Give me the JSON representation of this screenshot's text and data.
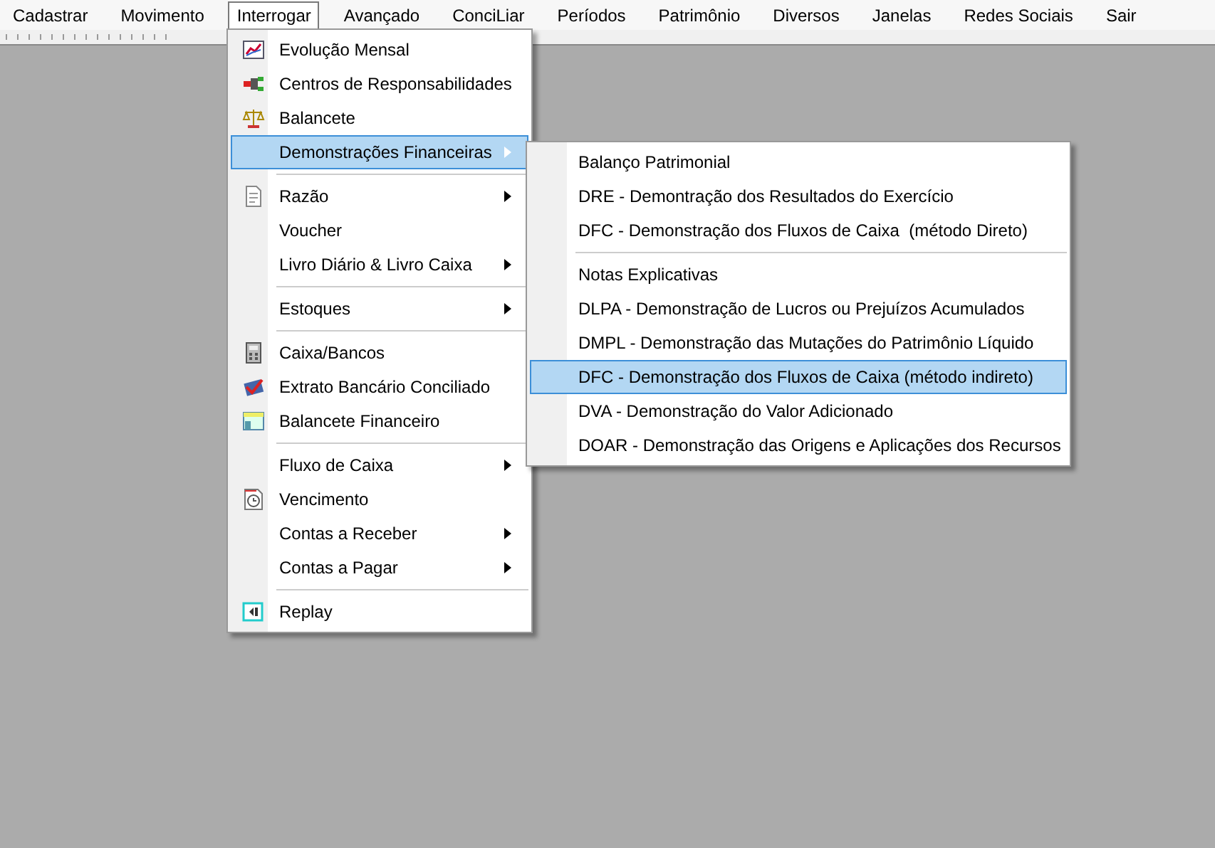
{
  "menu_bar": [
    {
      "label": "Cadastrar",
      "selected": false
    },
    {
      "label": "Movimento",
      "selected": false
    },
    {
      "label": "Interrogar",
      "selected": true
    },
    {
      "label": "Avançado",
      "selected": false
    },
    {
      "label": "ConciLiar",
      "selected": false
    },
    {
      "label": "Períodos",
      "selected": false
    },
    {
      "label": "Patrimônio",
      "selected": false
    },
    {
      "label": "Diversos",
      "selected": false
    },
    {
      "label": "Janelas",
      "selected": false
    },
    {
      "label": "Redes Sociais",
      "selected": false
    },
    {
      "label": "Sair",
      "selected": false
    }
  ],
  "menu": [
    {
      "kind": "item",
      "label": "Evolução Mensal",
      "selected": false,
      "submenu": false
    },
    {
      "kind": "item",
      "label": "Centros de Responsabilidades",
      "selected": false,
      "submenu": false
    },
    {
      "kind": "item",
      "label": "Balancete",
      "selected": false,
      "submenu": false
    },
    {
      "kind": "item",
      "label": "Demonstrações Financeiras",
      "selected": true,
      "submenu": true
    },
    {
      "kind": "separator"
    },
    {
      "kind": "item",
      "label": "Razão",
      "selected": false,
      "submenu": true
    },
    {
      "kind": "item",
      "label": "Voucher",
      "selected": false,
      "submenu": false
    },
    {
      "kind": "item",
      "label": "Livro Diário & Livro Caixa",
      "selected": false,
      "submenu": true
    },
    {
      "kind": "separator"
    },
    {
      "kind": "item",
      "label": "Estoques",
      "selected": false,
      "submenu": true
    },
    {
      "kind": "separator"
    },
    {
      "kind": "item",
      "label": "Caixa/Bancos",
      "selected": false,
      "submenu": false
    },
    {
      "kind": "item",
      "label": "Extrato Bancário Conciliado",
      "selected": false,
      "submenu": false
    },
    {
      "kind": "item",
      "label": "Balancete Financeiro",
      "selected": false,
      "submenu": false
    },
    {
      "kind": "separator"
    },
    {
      "kind": "item",
      "label": "Fluxo de Caixa",
      "selected": false,
      "submenu": true
    },
    {
      "kind": "item",
      "label": "Vencimento",
      "selected": false,
      "submenu": false
    },
    {
      "kind": "item",
      "label": "Contas a Receber",
      "selected": false,
      "submenu": true
    },
    {
      "kind": "item",
      "label": "Contas a Pagar",
      "selected": false,
      "submenu": true
    },
    {
      "kind": "separator"
    },
    {
      "kind": "item",
      "label": "Replay",
      "selected": false,
      "submenu": false
    }
  ],
  "submenu": [
    {
      "kind": "item",
      "label": "Balanço Patrimonial",
      "selected": false
    },
    {
      "kind": "item",
      "label": "DRE - Demontração dos Resultados do Exercício",
      "selected": false
    },
    {
      "kind": "item",
      "label": "DFC - Demonstração dos Fluxos de Caixa  (método Direto)",
      "selected": false
    },
    {
      "kind": "separator"
    },
    {
      "kind": "item",
      "label": "Notas Explicativas",
      "selected": false
    },
    {
      "kind": "item",
      "label": "DLPA - Demonstração de Lucros ou Prejuízos Acumulados",
      "selected": false
    },
    {
      "kind": "item",
      "label": "DMPL - Demonstração das Mutações do Patrimônio Líquido",
      "selected": false
    },
    {
      "kind": "item",
      "label": "DFC - Demonstração dos Fluxos de Caixa (método indireto)",
      "selected": true
    },
    {
      "kind": "item",
      "label": "DVA - Demonstração do Valor Adicionado",
      "selected": false
    },
    {
      "kind": "item",
      "label": "DOAR - Demonstração das Origens e Aplicações dos Recursos",
      "selected": false
    }
  ]
}
